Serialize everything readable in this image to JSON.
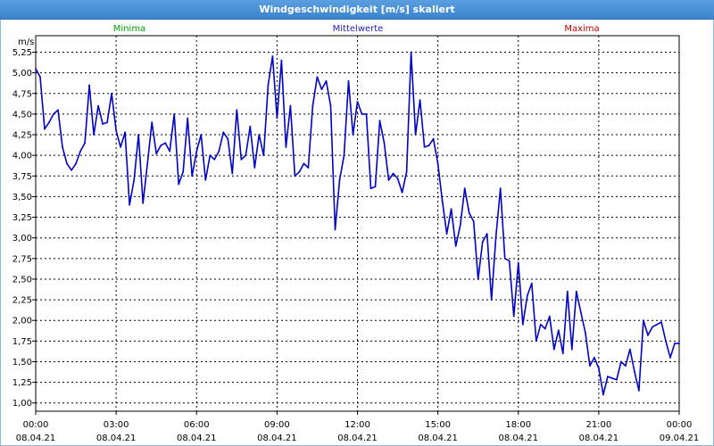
{
  "window": {
    "title": "Windgeschwindigkeit [m/s] skaliert"
  },
  "legend": [
    {
      "label": "Minima",
      "color": "#00a000"
    },
    {
      "label": "Mittelwerte",
      "color": "#2020c0"
    },
    {
      "label": "Maxima",
      "color": "#c00000"
    }
  ],
  "chart_data": {
    "type": "line",
    "title": "Windgeschwindigkeit [m/s] skaliert",
    "ylabel": "m/s",
    "xlabel": "",
    "ylim": [
      0.9,
      5.45
    ],
    "xlim": [
      "08.04.21 00:00",
      "09.04.21 00:00"
    ],
    "y_ticks": [
      "5,25",
      "5,00",
      "4,75",
      "4,50",
      "4,25",
      "4,00",
      "3,75",
      "3,50",
      "3,25",
      "3,00",
      "2,75",
      "2,50",
      "2,25",
      "2,00",
      "1,75",
      "1,50",
      "1,25",
      "1,00"
    ],
    "x_ticks": [
      {
        "time": "00:00",
        "date": "08.04.21"
      },
      {
        "time": "03:00",
        "date": "08.04.21"
      },
      {
        "time": "06:00",
        "date": "08.04.21"
      },
      {
        "time": "09:00",
        "date": "08.04.21"
      },
      {
        "time": "12:00",
        "date": "08.04.21"
      },
      {
        "time": "15:00",
        "date": "08.04.21"
      },
      {
        "time": "18:00",
        "date": "08.04.21"
      },
      {
        "time": "21:00",
        "date": "08.04.21"
      },
      {
        "time": "00:00",
        "date": "09.04.21"
      }
    ],
    "grid": true,
    "line_color": "#0000c8",
    "series": [
      {
        "name": "Mittelwerte",
        "x": [
          "00:00",
          "00:10",
          "00:20",
          "00:30",
          "00:40",
          "00:50",
          "01:00",
          "01:10",
          "01:20",
          "01:30",
          "01:40",
          "01:50",
          "02:00",
          "02:10",
          "02:20",
          "02:30",
          "02:40",
          "02:50",
          "03:00",
          "03:10",
          "03:20",
          "03:30",
          "03:40",
          "03:50",
          "04:00",
          "04:10",
          "04:20",
          "04:30",
          "04:40",
          "04:50",
          "05:00",
          "05:10",
          "05:20",
          "05:30",
          "05:40",
          "05:50",
          "06:00",
          "06:10",
          "06:20",
          "06:30",
          "06:40",
          "06:50",
          "07:00",
          "07:10",
          "07:20",
          "07:30",
          "07:40",
          "07:50",
          "08:00",
          "08:10",
          "08:20",
          "08:30",
          "08:40",
          "08:50",
          "09:00",
          "09:10",
          "09:20",
          "09:30",
          "09:40",
          "09:50",
          "10:00",
          "10:10",
          "10:20",
          "10:30",
          "10:40",
          "10:50",
          "11:00",
          "11:10",
          "11:20",
          "11:30",
          "11:40",
          "11:50",
          "12:00",
          "12:10",
          "12:20",
          "12:30",
          "12:40",
          "12:50",
          "13:00",
          "13:10",
          "13:20",
          "13:30",
          "13:40",
          "13:50",
          "14:00",
          "14:10",
          "14:20",
          "14:30",
          "14:40",
          "14:50",
          "15:00",
          "15:10",
          "15:20",
          "15:30",
          "15:40",
          "15:50",
          "16:00",
          "16:10",
          "16:20",
          "16:30",
          "16:40",
          "16:50",
          "17:00",
          "17:10",
          "17:20",
          "17:30",
          "17:40",
          "17:50",
          "18:00",
          "18:10",
          "18:20",
          "18:30",
          "18:40",
          "18:50",
          "19:00",
          "19:10",
          "19:20",
          "19:30",
          "19:40",
          "19:50",
          "20:00",
          "20:10",
          "20:20",
          "20:30",
          "20:40",
          "20:50",
          "21:00",
          "21:10",
          "21:20",
          "21:30",
          "21:40",
          "21:50",
          "22:00",
          "22:10",
          "22:20",
          "22:30",
          "22:40",
          "22:50",
          "23:00",
          "23:10",
          "23:20",
          "23:30",
          "23:40",
          "23:50",
          "24:00"
        ],
        "values": [
          5.05,
          4.95,
          4.32,
          4.4,
          4.5,
          4.55,
          4.1,
          3.9,
          3.82,
          3.9,
          4.05,
          4.15,
          4.85,
          4.25,
          4.6,
          4.38,
          4.4,
          4.75,
          4.3,
          4.1,
          4.28,
          3.4,
          3.7,
          4.25,
          3.42,
          3.9,
          4.4,
          4.02,
          4.12,
          4.15,
          4.05,
          4.5,
          3.65,
          3.8,
          4.45,
          3.75,
          4.05,
          4.25,
          3.7,
          4.0,
          3.95,
          4.05,
          4.28,
          4.2,
          3.78,
          4.55,
          3.95,
          4.0,
          4.35,
          3.85,
          4.25,
          4.0,
          4.85,
          5.2,
          4.45,
          5.15,
          4.1,
          4.6,
          3.75,
          3.8,
          3.9,
          3.85,
          4.6,
          4.95,
          4.8,
          4.9,
          4.6,
          3.1,
          3.7,
          4.0,
          4.9,
          4.25,
          4.65,
          4.5,
          4.5,
          3.6,
          3.62,
          4.42,
          4.15,
          3.7,
          3.78,
          3.72,
          3.55,
          3.8,
          5.25,
          4.25,
          4.67,
          4.1,
          4.12,
          4.2,
          3.9,
          3.45,
          3.05,
          3.35,
          2.9,
          3.15,
          3.6,
          3.3,
          3.2,
          2.5,
          2.95,
          3.05,
          2.25,
          3.02,
          3.6,
          2.75,
          2.72,
          2.05,
          2.7,
          1.95,
          2.3,
          2.45,
          1.75,
          1.95,
          1.9,
          2.05,
          1.65,
          1.88,
          1.6,
          2.35,
          1.65,
          2.35,
          2.1,
          1.85,
          1.45,
          1.55,
          1.42,
          1.1,
          1.32,
          1.3,
          1.28,
          1.5,
          1.45,
          1.65,
          1.38,
          1.15,
          2.0,
          1.82,
          1.92,
          1.95,
          1.98,
          1.75,
          1.55,
          1.72,
          1.72
        ]
      }
    ]
  }
}
